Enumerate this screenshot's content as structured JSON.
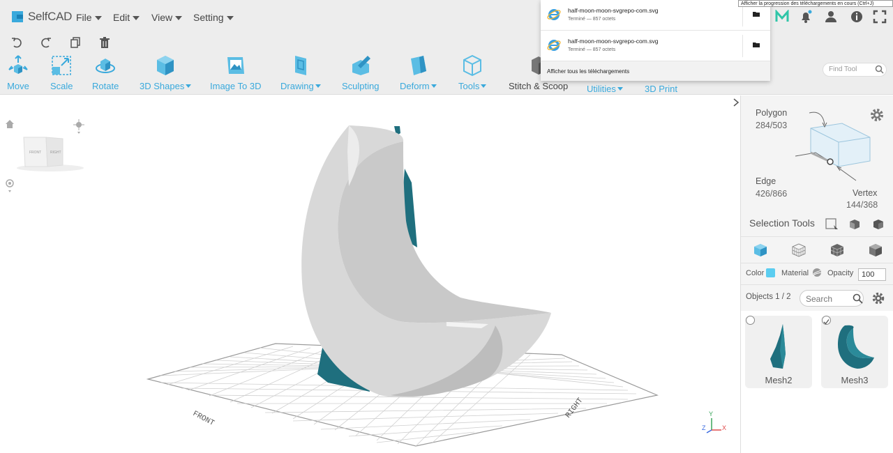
{
  "app": {
    "name": "SelfCAD"
  },
  "menu": {
    "items": [
      {
        "label": "File"
      },
      {
        "label": "Edit"
      },
      {
        "label": "View"
      },
      {
        "label": "Setting"
      }
    ]
  },
  "toolbar": {
    "tools": [
      {
        "label": "Move",
        "dropdown": false
      },
      {
        "label": "Scale",
        "dropdown": false
      },
      {
        "label": "Rotate",
        "dropdown": false
      },
      {
        "label": "3D Shapes",
        "dropdown": true
      },
      {
        "label": "Image To 3D",
        "dropdown": false
      },
      {
        "label": "Drawing",
        "dropdown": true
      },
      {
        "label": "Sculpting",
        "dropdown": false
      },
      {
        "label": "Deform",
        "dropdown": true
      },
      {
        "label": "Tools",
        "dropdown": true
      },
      {
        "label": "Stitch & Scoop",
        "dropdown": false
      },
      {
        "label": "Utilities",
        "dropdown": true
      },
      {
        "label": "3D Print",
        "dropdown": false
      }
    ],
    "find_placeholder": "Find Tool"
  },
  "downloads": {
    "tooltip": "Afficher la progression des téléchargements en cours (Ctrl+J)",
    "items": [
      {
        "name": "half-moon-moon-svgrepo-com.svg",
        "status": "Terminé — 857 octets"
      },
      {
        "name": "half-moon-moon-svgrepo-com.svg",
        "status": "Terminé — 857 octets"
      }
    ],
    "show_all": "Afficher tous les téléchargements"
  },
  "viewport": {
    "cube_front": "FRONT",
    "cube_right": "RIGHT",
    "floor_front": "FRONT",
    "floor_right": "RIGHT",
    "axis_y": "Y",
    "axis_z": "Z",
    "axis_x": "X"
  },
  "panel": {
    "polygon_label": "Polygon",
    "polygon_count": "284/503",
    "edge_label": "Edge",
    "edge_count": "426/866",
    "vertex_label": "Vertex",
    "vertex_count": "144/368",
    "selection_tools": "Selection Tools",
    "color_label": "Color",
    "material_label": "Material",
    "opacity_label": "Opacity",
    "opacity_value": "100",
    "objects_label": "Objects 1 / 2",
    "search_placeholder": "Search",
    "objects": [
      {
        "name": "Mesh2",
        "selected": false
      },
      {
        "name": "Mesh3",
        "selected": true
      }
    ]
  },
  "colors": {
    "accent": "#39a9dc",
    "mesh_teal": "#1f6f7e",
    "mesh_white": "#d9d9d9"
  }
}
